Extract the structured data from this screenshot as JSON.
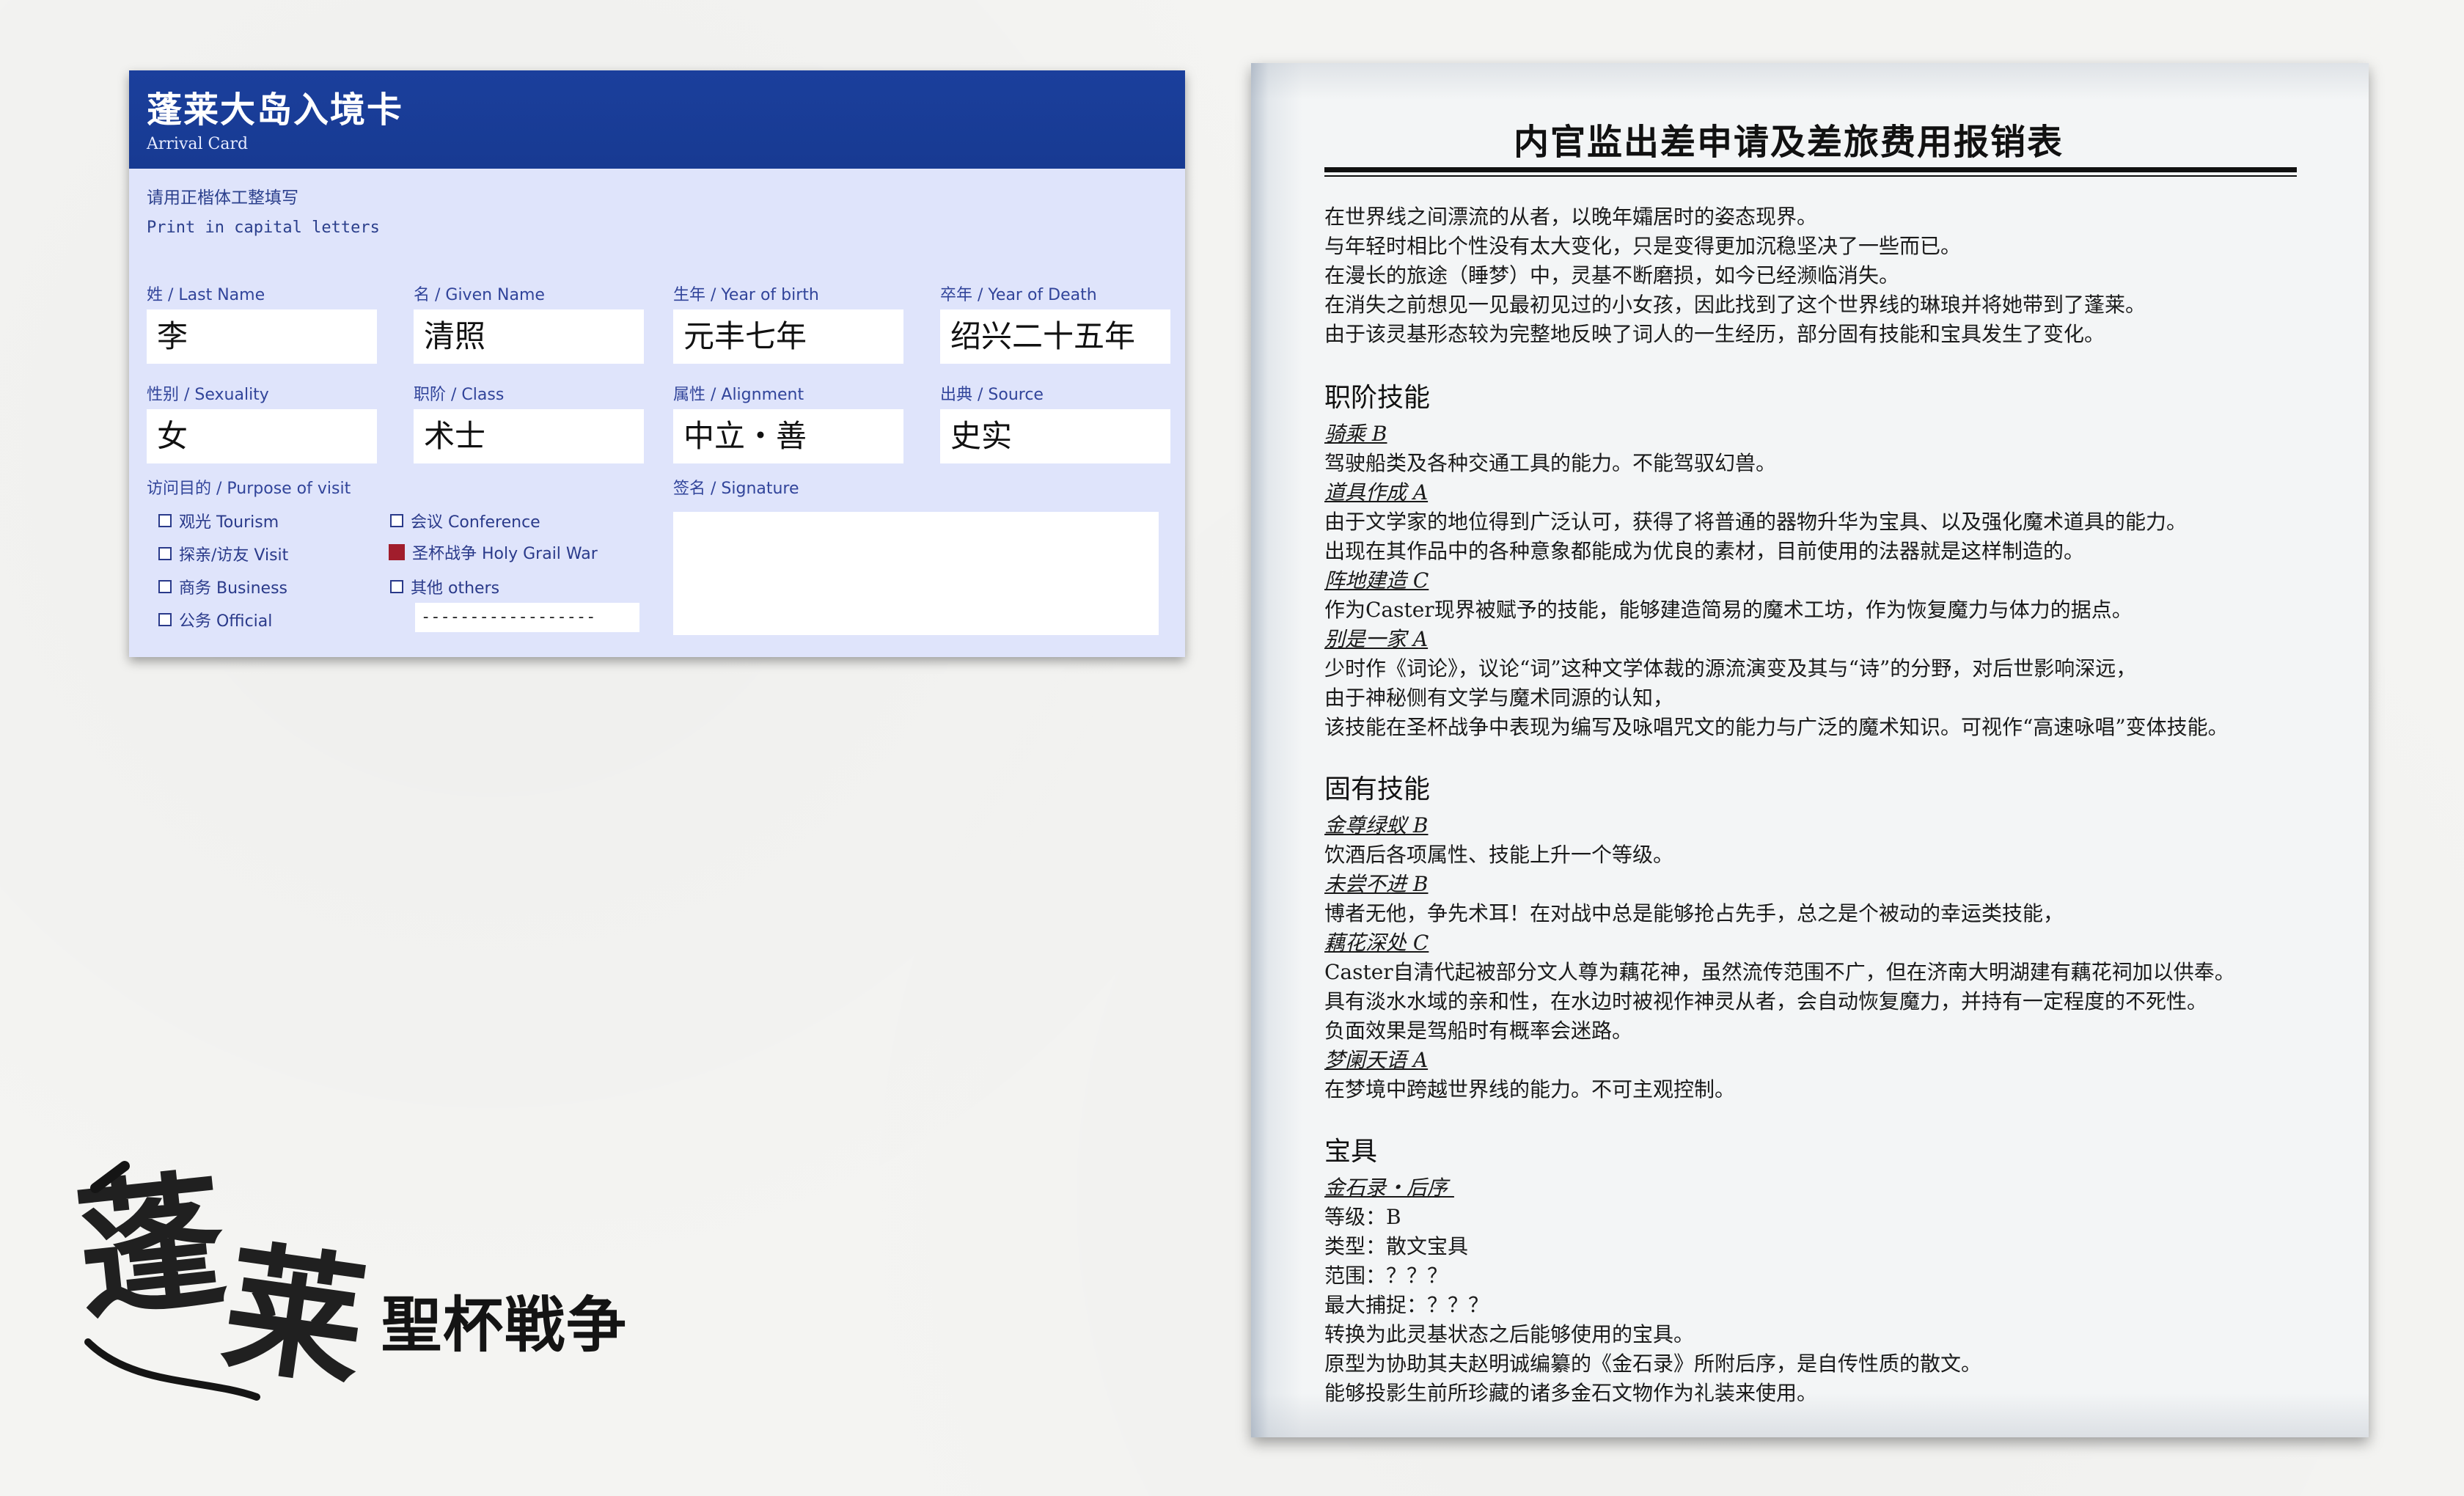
{
  "arrival_card": {
    "title": "蓬莱大岛入境卡",
    "subtitle": "Arrival Card",
    "instruction_cn": "请用正楷体工整填写",
    "instruction_en": "Print in capital letters",
    "fields": {
      "last_name": {
        "label": "姓 / Last Name",
        "value": "李"
      },
      "given_name": {
        "label": "名 / Given Name",
        "value": "清照"
      },
      "birth": {
        "label": "生年 / Year of birth",
        "value": "元丰七年"
      },
      "death": {
        "label": "卒年 / Year of Death",
        "value": "绍兴二十五年"
      },
      "sexuality": {
        "label": "性别 / Sexuality",
        "value": "女"
      },
      "class": {
        "label": "职阶 / Class",
        "value": "术士"
      },
      "alignment": {
        "label": "属性 / Alignment",
        "value": "中立・善"
      },
      "source": {
        "label": "出典 / Source",
        "value": "史实"
      }
    },
    "purpose_label": "访问目的 / Purpose of visit",
    "purposes": [
      {
        "label": "观光 Tourism",
        "checked": false
      },
      {
        "label": "探亲/访友 Visit",
        "checked": false
      },
      {
        "label": "商务 Business",
        "checked": false
      },
      {
        "label": "公务 Official",
        "checked": false
      },
      {
        "label": "会议 Conference",
        "checked": false
      },
      {
        "label": "圣杯战争 Holy Grail War",
        "checked": true
      },
      {
        "label": "其他 others",
        "checked": false
      }
    ],
    "other_line": "------------------",
    "signature_label": "签名 / Signature",
    "colors": {
      "header": "#1b3f9c",
      "card": "#dfe4fb",
      "checked": "#a11d2c"
    }
  },
  "report": {
    "title": "内官监出差申请及差旅费用报销表",
    "intro": [
      "在世界线之间漂流的从者，以晚年孀居时的姿态现界。",
      "与年轻时相比个性没有太大变化，只是变得更加沉稳坚决了一些而已。",
      "在漫长的旅途（睡梦）中，灵基不断磨损，如今已经濒临消失。",
      "在消失之前想见一见最初见过的小女孩，因此找到了这个世界线的琳琅并将她带到了蓬莱。",
      "由于该灵基形态较为完整地反映了词人的一生经历，部分固有技能和宝具发生了变化。"
    ],
    "class_skills_title": "职阶技能",
    "class_skills": [
      {
        "name": "骑乘 B",
        "desc": [
          "驾驶船类及各种交通工具的能力。不能驾驭幻兽。"
        ]
      },
      {
        "name": "道具作成 A",
        "desc": [
          "由于文学家的地位得到广泛认可，获得了将普通的器物升华为宝具、以及强化魔术道具的能力。",
          "出现在其作品中的各种意象都能成为优良的素材，目前使用的法器就是这样制造的。"
        ]
      },
      {
        "name": "阵地建造 C",
        "desc": [
          "作为Caster现界被赋予的技能，能够建造简易的魔术工坊，作为恢复魔力与体力的据点。"
        ]
      },
      {
        "name": "别是一家 A",
        "desc": [
          "少时作《词论》，议论“词”这种文学体裁的源流演变及其与“诗”的分野，对后世影响深远，",
          "由于神秘侧有文学与魔术同源的认知，",
          "该技能在圣杯战争中表现为编写及咏唱咒文的能力与广泛的魔术知识。可视作“高速咏唱”变体技能。"
        ]
      }
    ],
    "personal_skills_title": "固有技能",
    "personal_skills": [
      {
        "name": "金尊绿蚁 B",
        "desc": [
          "饮酒后各项属性、技能上升一个等级。"
        ]
      },
      {
        "name": "未尝不进 B",
        "desc": [
          "博者无他，争先术耳！在对战中总是能够抢占先手，总之是个被动的幸运类技能，"
        ]
      },
      {
        "name": "藕花深处 C",
        "desc": [
          "Caster自清代起被部分文人尊为藕花神，虽然流传范围不广，但在济南大明湖建有藕花祠加以供奉。",
          "具有淡水水域的亲和性，在水边时被视作神灵从者，会自动恢复魔力，并持有一定程度的不死性。",
          "负面效果是驾船时有概率会迷路。"
        ]
      },
      {
        "name": "梦阑天语 A",
        "desc": [
          "在梦境中跨越世界线的能力。不可主观控制。"
        ]
      }
    ],
    "np_title": "宝具",
    "np_name": "金石录・后序 ",
    "np_lines": [
      "等级：B",
      "类型：散文宝具",
      "范围：？？？",
      "最大捕捉：？？？",
      "转换为此灵基状态之后能够使用的宝具。",
      "原型为协助其夫赵明诚编纂的《金石录》所附后序，是自传性质的散文。",
      "能够投影生前所珍藏的诸多金石文物作为礼装来使用。"
    ]
  },
  "logo": {
    "text": "聖杯戦争",
    "brush_text": "蓬莱"
  }
}
